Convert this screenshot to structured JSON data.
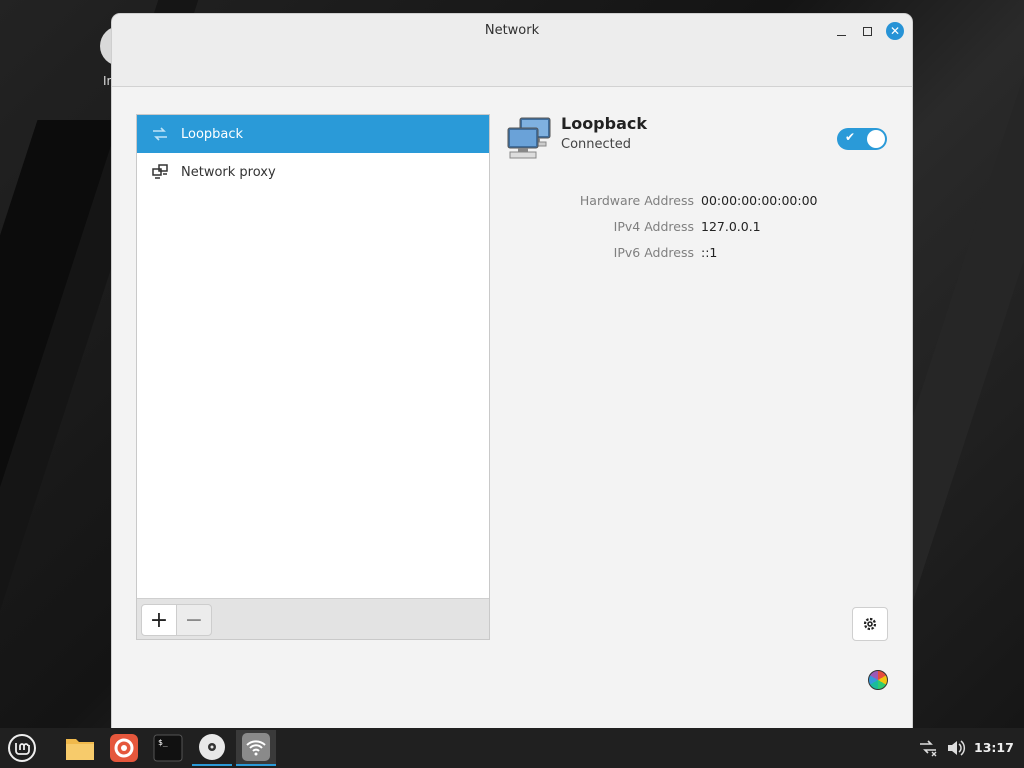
{
  "desktop": {
    "icon_label_partial": "In"
  },
  "window": {
    "title": "Network"
  },
  "list": {
    "items": [
      {
        "label": "Loopback",
        "icon": "network-transmit-receive-icon",
        "selected": true
      },
      {
        "label": "Network proxy",
        "icon": "network-proxy-icon",
        "selected": false
      }
    ],
    "add_label": "+",
    "remove_label": "−"
  },
  "detail": {
    "name": "Loopback",
    "status": "Connected",
    "toggle_on": true,
    "properties": [
      {
        "key": "Hardware Address",
        "value": "00:00:00:00:00:00"
      },
      {
        "key": "IPv4 Address",
        "value": "127.0.0.1"
      },
      {
        "key": "IPv6 Address",
        "value": "::1"
      }
    ]
  },
  "taskbar": {
    "apps": [
      "mint-menu-icon",
      "files-icon",
      "firefox-icon",
      "terminal-icon",
      "disc-icon",
      "network-wifi-icon"
    ],
    "clock": "13:17"
  },
  "colors": {
    "accent": "#2a9ad8"
  }
}
